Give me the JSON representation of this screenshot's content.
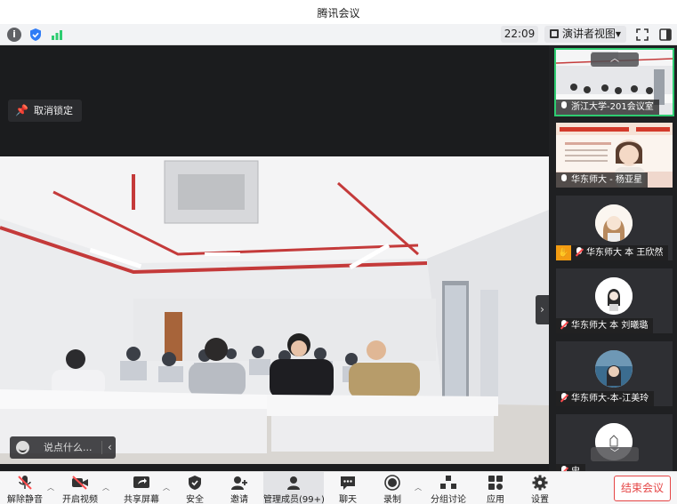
{
  "window": {
    "title": "腾讯会议"
  },
  "infobar": {
    "time": "22:09",
    "view_label": "演讲者视图"
  },
  "stage": {
    "unpin_label": "取消锁定",
    "chat_placeholder": "说点什么..."
  },
  "participants": [
    {
      "name": "浙江大学-201会议室"
    },
    {
      "name": "华东师大 - 杨亚星"
    },
    {
      "name": "华东师大 本 王欣然"
    },
    {
      "name": "华东师大 本 刘曦璐"
    },
    {
      "name": "华东师大-本-江美玲"
    },
    {
      "name": "史"
    }
  ],
  "toolbar": {
    "unmute": "解除静音",
    "start_video": "开启视频",
    "share_screen": "共享屏幕",
    "security": "安全",
    "invite": "邀请",
    "manage_members": "管理成员(99+)",
    "chat": "聊天",
    "record": "录制",
    "breakout": "分组讨论",
    "apps": "应用",
    "settings": "设置",
    "end_meeting": "结束会议"
  },
  "colors": {
    "active_tile": "#2ecc71",
    "end_button": "#e54545",
    "mute_red": "#ff4d4f"
  }
}
